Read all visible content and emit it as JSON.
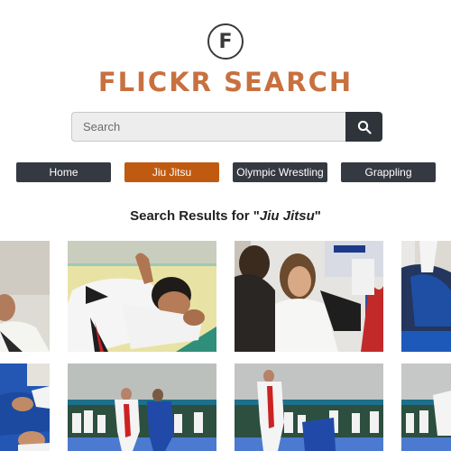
{
  "logo": {
    "letter": "F",
    "text": "FLICKR SEARCH"
  },
  "search": {
    "placeholder": "Search",
    "value": ""
  },
  "nav": {
    "items": [
      "Home",
      "Jiu Jitsu",
      "Olympic Wrestling",
      "Grappling"
    ],
    "active": "Jiu Jitsu"
  },
  "results": {
    "prefix": "Search Results for \"",
    "query": "Jiu Jitsu",
    "suffix": "\""
  },
  "icons": {
    "search_button": "search-icon",
    "logo": "flickr-f-icon"
  },
  "colors": {
    "brand": "#c8703f",
    "active_nav": "#c05a10",
    "nav": "#353a42",
    "search_button": "#2f343b"
  }
}
